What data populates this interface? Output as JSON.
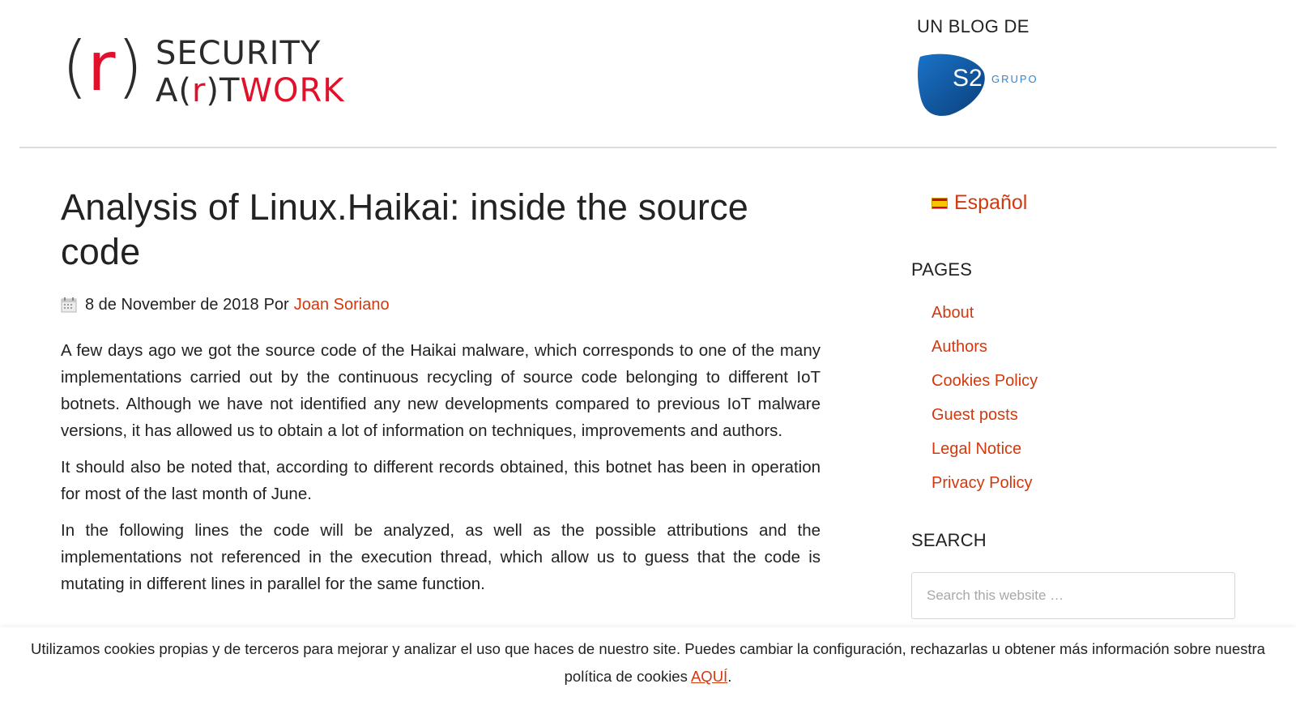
{
  "header": {
    "logo": {
      "paren_left": "(",
      "r": "r",
      "paren_right": ")",
      "line1": "SECURITY",
      "line2_a": "A(",
      "line2_r": "r",
      "line2_b": ")T",
      "line2_c": "WORK"
    },
    "blog_by": "UN BLOG DE",
    "partner_logo": {
      "mark": "S2",
      "text": "GRUPO",
      "color": "#0d5aa7"
    }
  },
  "article": {
    "title": "Analysis of Linux.Haikai: inside the source code",
    "meta": {
      "date_icon": "calendar-icon",
      "date": "8 de November de 2018",
      "by": "Por",
      "author": "Joan Soriano"
    },
    "paragraphs": [
      "A few days ago we got the source code of the Haikai malware, which corresponds to one of the many implementations carried out by the continuous recycling of source code belonging to different IoT botnets. Although we have not identified any new developments compared to previous IoT malware versions, it has allowed us to obtain a lot of information on techniques, improvements and authors.",
      "It should also be noted that, according to different records obtained, this botnet has been in operation for most of the last month of June.",
      "In the following lines the code will be analyzed, as well as the possible attributions and the implementations not referenced in the execution thread, which allow us to guess that the code is mutating in different lines in parallel for the same function."
    ]
  },
  "sidebar": {
    "language": {
      "flag_icon": "spain-flag-icon",
      "label": "Español"
    },
    "pages": {
      "title": "PAGES",
      "items": [
        "About",
        "Authors",
        "Cookies Policy",
        "Guest posts",
        "Legal Notice",
        "Privacy Policy"
      ]
    },
    "search": {
      "title": "SEARCH",
      "placeholder": "Search this website …"
    }
  },
  "cookie_banner": {
    "text": "Utilizamos cookies propias y de terceros para mejorar y analizar el uso que haces de nuestro site. Puedes cambiar la configuración, rechazarlas u obtener más información sobre nuestra política de cookies ",
    "link": "AQUÍ",
    "end": "."
  },
  "colors": {
    "accent": "#d4380d",
    "logo_red": "#e0112b",
    "text": "#222222"
  }
}
